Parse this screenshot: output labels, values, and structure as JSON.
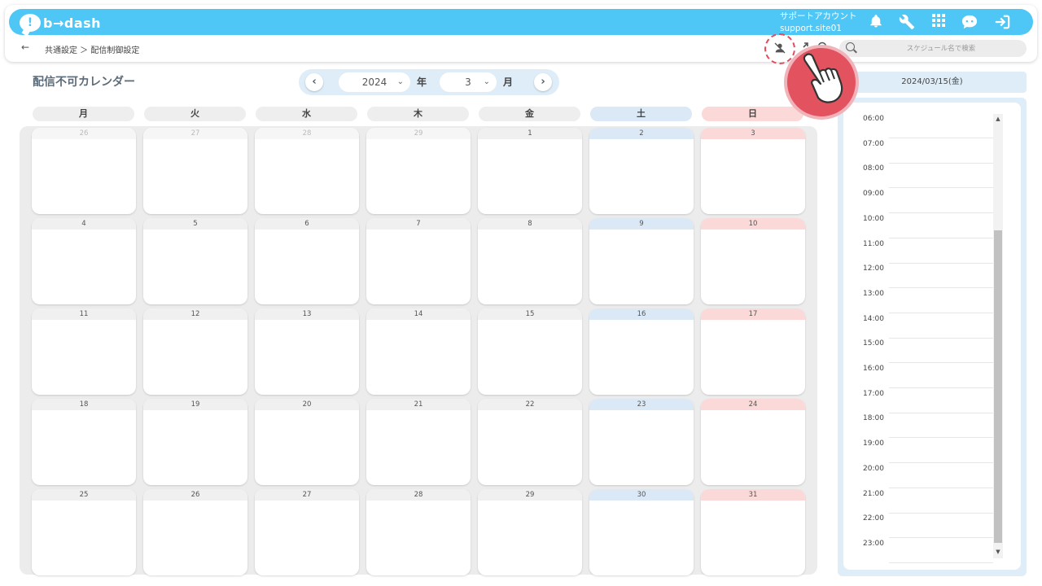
{
  "header": {
    "logo_mark": "!",
    "logo_text": "b→dash",
    "account_label": "サポートアカウント",
    "account_id": "support.site01",
    "icons": [
      "bell-icon",
      "wrench-icon",
      "apps-grid-icon",
      "support-chat-icon",
      "logout-icon"
    ]
  },
  "subbar": {
    "back": "←",
    "breadcrumb": "共通設定 ＞ 配信制御設定",
    "icons": [
      "user-block-icon",
      "expand-icon",
      "search-icon"
    ],
    "search_placeholder": "スケジュール名で検索"
  },
  "calendar": {
    "title": "配信不可カレンダー",
    "year": "2024",
    "year_suffix": "年",
    "month": "3",
    "month_suffix": "月",
    "prev": "‹",
    "next": "›",
    "weekdays": [
      "月",
      "火",
      "水",
      "木",
      "金",
      "土",
      "日"
    ],
    "weeks": [
      [
        "26",
        "27",
        "28",
        "29",
        "1",
        "2",
        "3"
      ],
      [
        "4",
        "5",
        "6",
        "7",
        "8",
        "9",
        "10"
      ],
      [
        "11",
        "12",
        "13",
        "14",
        "15",
        "16",
        "17"
      ],
      [
        "18",
        "19",
        "20",
        "21",
        "22",
        "23",
        "24"
      ],
      [
        "25",
        "26",
        "27",
        "28",
        "29",
        "30",
        "31"
      ]
    ]
  },
  "side": {
    "date": "2024/03/15(金)",
    "times": [
      "06:00",
      "07:00",
      "08:00",
      "09:00",
      "10:00",
      "11:00",
      "12:00",
      "13:00",
      "14:00",
      "15:00",
      "16:00",
      "17:00",
      "18:00",
      "19:00",
      "20:00",
      "21:00",
      "22:00",
      "23:00"
    ]
  },
  "colors": {
    "brand": "#4ec7f7",
    "saturday": "#dbe9f7",
    "sunday": "#fbd9d9",
    "highlight": "#e24a5a"
  }
}
